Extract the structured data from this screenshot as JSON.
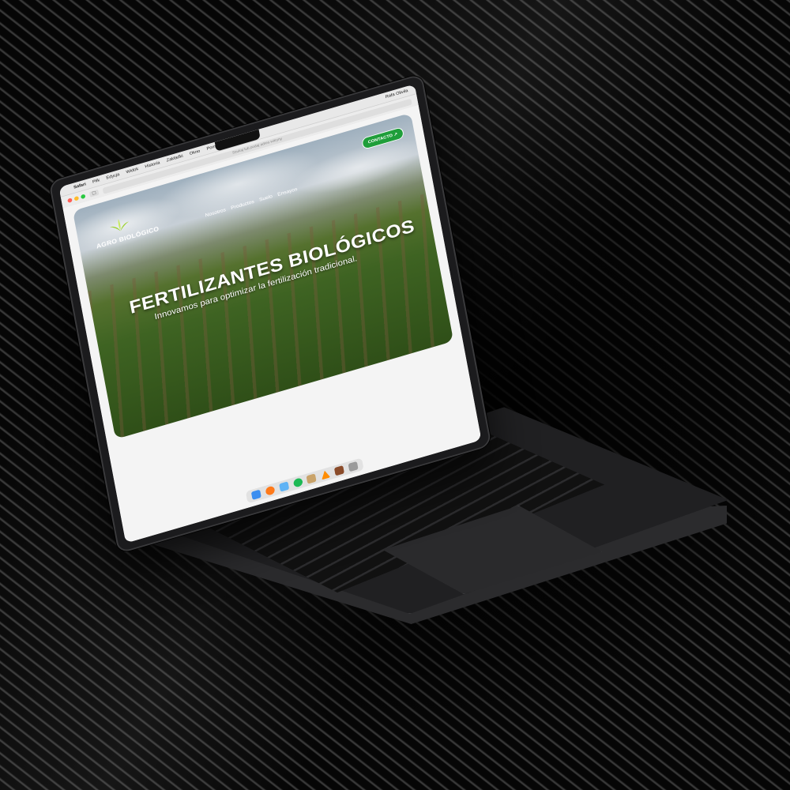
{
  "menubar": {
    "items": [
      "Safari",
      "Plik",
      "Edycja",
      "Widok",
      "Historia",
      "Zakładki",
      "Okno",
      "Pomoc"
    ],
    "user": "Rafa Olivila"
  },
  "browser": {
    "url_placeholder": "Szukaj lub podaj adres witryny",
    "tab_button": "▢"
  },
  "site": {
    "logo_text": "AGRO BIOLÓGICO",
    "nav": [
      "Nosotros",
      "Productos",
      "Suelo",
      "Ensayos"
    ],
    "contact_button": "CONTACTO ↗",
    "headline": "FERTILIZANTES BIOLÓGICOS",
    "subline": "Innovamos para optimizar la fertilización tradicional."
  },
  "colors": {
    "accent_green": "#1f9e3a",
    "leaf_green": "#9bd12a"
  },
  "dock": {
    "apps": [
      "finder-icon",
      "firefox-icon",
      "mail-icon",
      "spotify-icon",
      "app-icon",
      "vlc-icon",
      "photo-icon",
      "trash-icon"
    ]
  }
}
